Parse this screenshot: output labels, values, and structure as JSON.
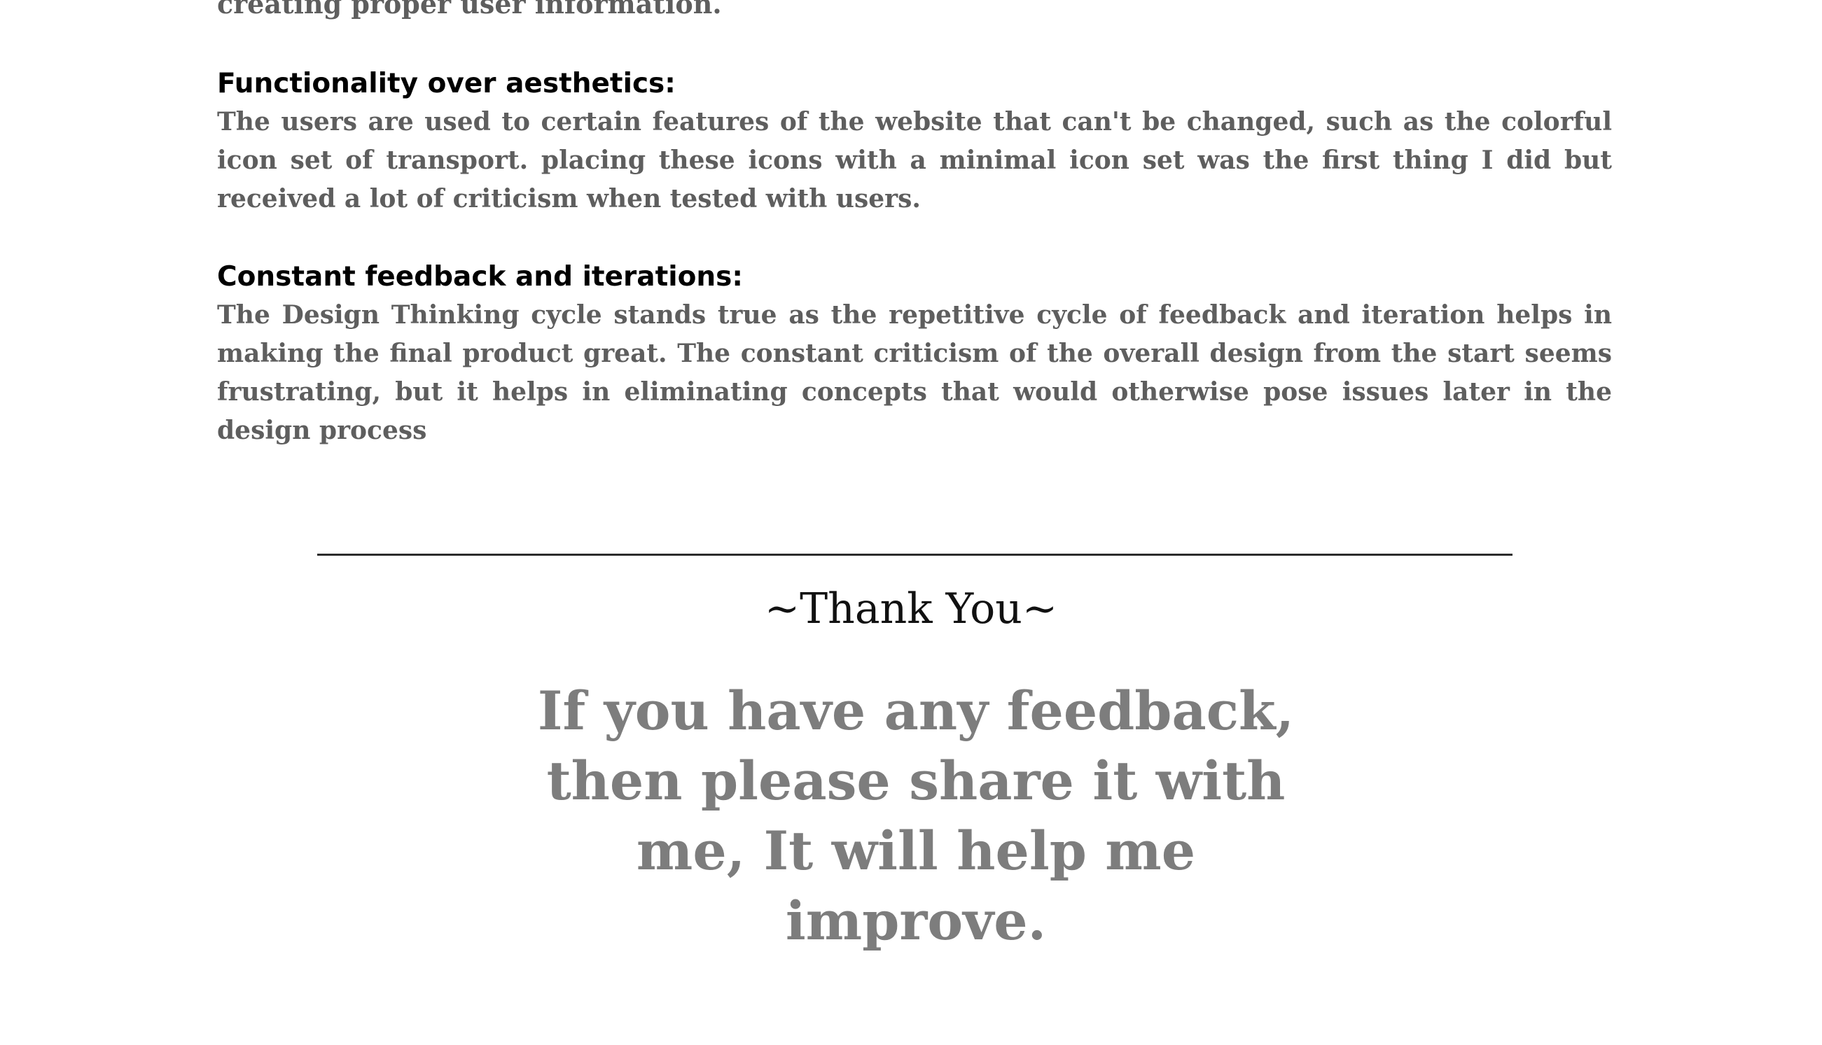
{
  "intro": {
    "trailing_line": "creating proper user information."
  },
  "sections": [
    {
      "heading": "Functionality over aesthetics:",
      "body": "The users are used to certain features of the website that can't be changed, such as the colorful icon set of transport. placing these icons with a minimal icon set was the first thing I did but received a lot of criticism when tested with users."
    },
    {
      "heading": "Constant feedback and iterations:",
      "body": "The Design Thinking cycle stands true as the repetitive cycle of feedback and iteration helps in making the final product great. The constant criticism of the overall design from the start seems frustrating, but it helps in eliminating concepts that would otherwise pose issues later in the design process"
    }
  ],
  "closing": {
    "title": "~Thank You~",
    "message": "If you have any feedback, then please share it with me, It will help me improve."
  },
  "colors": {
    "heading": "#000000",
    "body_text": "#5e5e5e",
    "closing_message": "#7d7d7d",
    "divider": "#2c2c2c",
    "background": "#ffffff"
  }
}
